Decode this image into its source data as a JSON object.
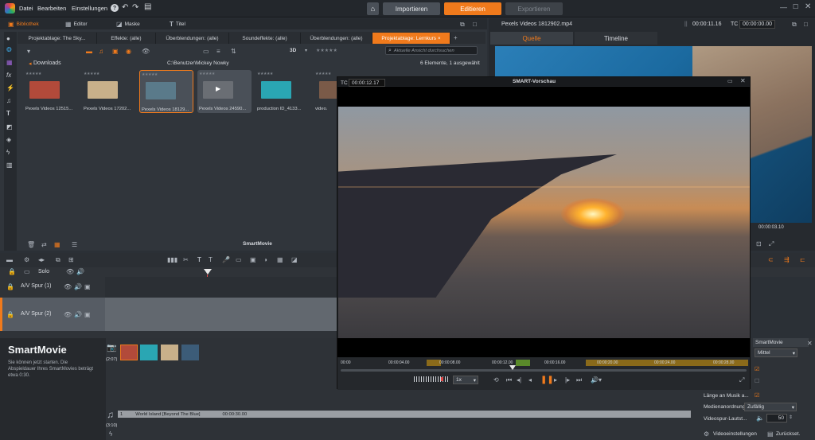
{
  "menu": {
    "file": "Datei",
    "edit": "Bearbeiten",
    "settings": "Einstellungen"
  },
  "modes": {
    "import": "Importieren",
    "edit": "Editieren",
    "export": "Exportieren"
  },
  "libtabs": {
    "library": "Bibliothek",
    "editor": "Editor",
    "mask": "Maske",
    "title": "Titel"
  },
  "subtabs": [
    "Projektablage: The Sky...",
    "Effekte: (alle)",
    "Überblendungen: (alle)",
    "Soundeffekte: (alle)",
    "Überblendungen: (alle)",
    "Projektablage: Lernkurs"
  ],
  "library": {
    "folder": "Downloads",
    "path": "C:\\Benutzer\\Mickey Nowky",
    "count": "6 Elemente, 1 ausgewählt",
    "search_placeholder": "Aktuelle Ansicht durchsuchen",
    "threed": "3D",
    "smartmovie": "SmartMovie"
  },
  "thumbs": [
    {
      "label": "Pexels Videos 12515...",
      "color": "#b24a3a"
    },
    {
      "label": "Pexels Videos 17202...",
      "color": "#c8b08a"
    },
    {
      "label": "Pexels Videos 18129...",
      "color": "#5a7a8a"
    },
    {
      "label": "Pexels Videos 24590...",
      "color": "#6a6e74"
    },
    {
      "label": "production ID_4133...",
      "color": "#2aa6b3"
    },
    {
      "label": "video.",
      "color": "#7a5a48"
    }
  ],
  "preview": {
    "filename": "Pexels Videos 1812902.mp4",
    "time": "00:00:11.16",
    "tc_label": "TC",
    "tc_value": "00:00:00.00",
    "tab_source": "Quelle",
    "tab_timeline": "Timeline",
    "bottom_time": "00:00:03.10"
  },
  "timeline": {
    "solo": "Solo",
    "track1": "A/V Spur (1)",
    "track2": "A/V Spur (2)"
  },
  "smartwin": {
    "title": "SMART-Vorschau",
    "tc_label": "TC",
    "tc_value": "00:00:12.17",
    "ticks": [
      "00:00",
      "00:00:04.00",
      "00:00:08.00",
      "00:00:12.00",
      "00:00:16.00",
      "00:00:20.00",
      "00:00:24.00",
      "00:00:28.00"
    ],
    "speed": "1x"
  },
  "smartmovie": {
    "title": "SmartMovie",
    "desc": "Sie können jetzt starten. Die Abspieldauer Ihres SmartMovies beträgt etwa 0:30.",
    "clip_dur": "(2:07)",
    "music_dur": "(3:10)",
    "music_num": "1",
    "music_title": "World Island [Beyond The Blue]",
    "music_time": "00:00:30.00"
  },
  "settings": {
    "header": "SmartMovie",
    "mittel": "Mittel",
    "fit_music": "Länge an Musik a...",
    "media_order": "Medienanordnung",
    "media_value": "Zufällig",
    "video_volume": "Videospur-Lautst...",
    "volume_value": "50",
    "video_settings": "Videoeinstellungen",
    "reset": "Zurückset."
  },
  "colors": {
    "accent": "#f07a1c",
    "panel": "#30353b"
  }
}
